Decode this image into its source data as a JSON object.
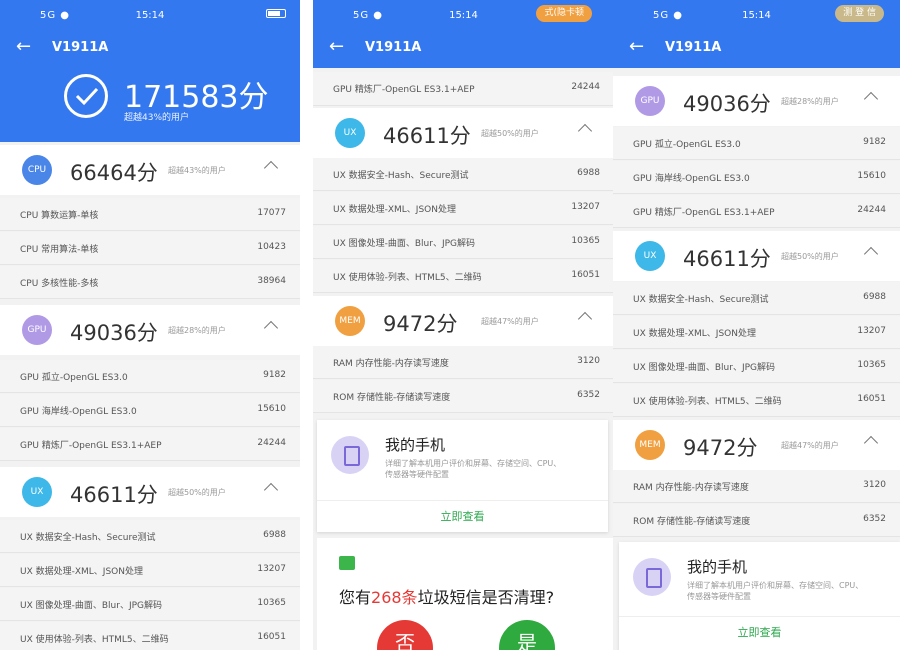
{
  "status_bar": {
    "signal": "5G ●",
    "time": "15:14"
  },
  "model": "V1911A",
  "total": {
    "score": "171583分",
    "rank": "超越43%的用户"
  },
  "pills": {
    "panel2": "式(隐卡顿",
    "panel3": "测 登 信"
  },
  "colors": {
    "blue": "#3478f0",
    "cpu": "#4a86e8",
    "gpu": "#b09ae6",
    "ux": "#3db8e8",
    "mem": "#f0a040",
    "green": "#2fa84f",
    "red": "#e53935"
  },
  "cpu": {
    "badge": "CPU",
    "score": "66464分",
    "rank": "超越43%的用户",
    "rows": [
      {
        "label": "CPU 算数运算-单核",
        "value": "17077"
      },
      {
        "label": "CPU 常用算法-单核",
        "value": "10423"
      },
      {
        "label": "CPU 多核性能-多核",
        "value": "38964"
      }
    ]
  },
  "gpu": {
    "badge": "GPU",
    "score": "49036分",
    "rank": "超越28%的用户",
    "rows": [
      {
        "label": "GPU 孤立-OpenGL ES3.0",
        "value": "9182"
      },
      {
        "label": "GPU 海岸线-OpenGL ES3.0",
        "value": "15610"
      },
      {
        "label": "GPU 精炼厂-OpenGL ES3.1+AEP",
        "value": "24244"
      }
    ]
  },
  "ux": {
    "badge": "UX",
    "score": "46611分",
    "rank": "超越50%的用户",
    "rows": [
      {
        "label": "UX 数据安全-Hash、Secure测试",
        "value": "6988"
      },
      {
        "label": "UX 数据处理-XML、JSON处理",
        "value": "13207"
      },
      {
        "label": "UX 图像处理-曲面、Blur、JPG解码",
        "value": "10365"
      },
      {
        "label": "UX 使用体验-列表、HTML5、二维码",
        "value": "16051"
      }
    ]
  },
  "mem": {
    "badge": "MEM",
    "score": "9472分",
    "rank": "超越47%的用户",
    "rows": [
      {
        "label": "RAM 内存性能-内存读写速度",
        "value": "3120"
      },
      {
        "label": "ROM 存储性能-存储读写速度",
        "value": "6352"
      }
    ]
  },
  "myphone": {
    "title": "我的手机",
    "desc": "详细了解本机用户评价和屏幕、存储空间、CPU、传感器等硬件配置",
    "link": "立即查看"
  },
  "promo": {
    "prefix": "您有",
    "count": "268条",
    "suffix": "垃圾短信是否清理?",
    "no": "否",
    "yes": "是"
  }
}
